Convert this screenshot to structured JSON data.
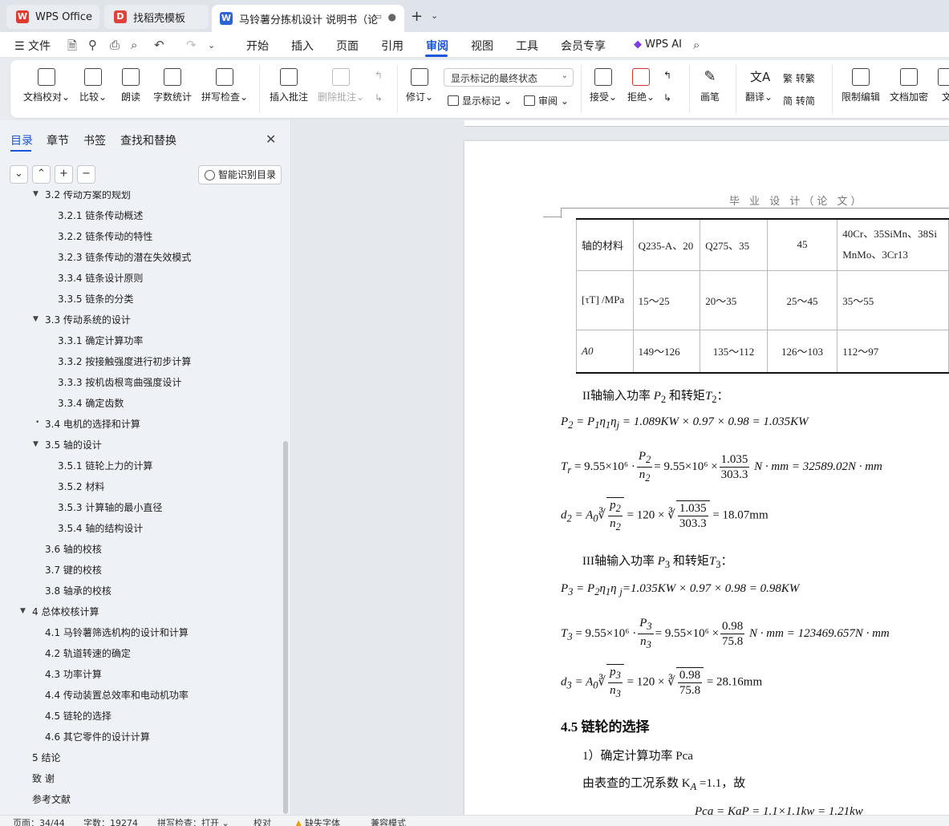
{
  "tabs": [
    {
      "label": "WPS Office",
      "icon": "wps-logo-icon"
    },
    {
      "label": "找稻壳模板",
      "icon": "docer-icon"
    },
    {
      "label": "马铃薯分拣机设计 说明书（论",
      "icon": "word-doc-icon"
    }
  ],
  "menu": {
    "file": "文件",
    "items": [
      "开始",
      "插入",
      "页面",
      "引用",
      "审阅",
      "视图",
      "工具",
      "会员专享"
    ],
    "active": "审阅",
    "ai": "WPS AI"
  },
  "ribbon": {
    "proofread": "文档校对",
    "compare": "比较",
    "read_aloud": "朗读",
    "word_count": "字数统计",
    "spell_check": "拼写检查",
    "insert_comment": "插入批注",
    "delete_comment": "删除批注",
    "track_changes": "修订",
    "markup_state": "显示标记的最终状态",
    "show_markup": "显示标记",
    "review": "审阅",
    "accept": "接受",
    "reject": "拒绝",
    "ink": "画笔",
    "translate": "翻译",
    "to_traditional": "转繁",
    "to_simplified": "转简",
    "restrict_edit": "限制编辑",
    "encrypt": "文档加密",
    "more": "文"
  },
  "panel": {
    "tabs": [
      "目录",
      "章节",
      "书签",
      "查找和替换"
    ],
    "smart_toc": "智能识别目录",
    "toc": [
      {
        "label": "3.2 传动方案的规划",
        "level": 1,
        "arrow": true
      },
      {
        "label": "3.2.1  链条传动概述",
        "level": 2
      },
      {
        "label": "3.2.2  链条传动的特性",
        "level": 2
      },
      {
        "label": "3.2.3  链条传动的潜在失效模式",
        "level": 2
      },
      {
        "label": "3.3.4  链条设计原则",
        "level": 2
      },
      {
        "label": "3.3.5  链条的分类",
        "level": 2
      },
      {
        "label": "3.3 传动系统的设计",
        "level": 1,
        "arrow": true
      },
      {
        "label": "3.3.1 确定计算功率",
        "level": 2
      },
      {
        "label": "3.3.2 按接触强度进行初步计算",
        "level": 2
      },
      {
        "label": "3.3.3 按机齿根弯曲强度设计",
        "level": 2
      },
      {
        "label": "3.3.4 确定齿数",
        "level": 2
      },
      {
        "label": "3.4 电机的选择和计算",
        "level": 1,
        "dot": true
      },
      {
        "label": "3.5 轴的设计",
        "level": 1,
        "arrow": true
      },
      {
        "label": "3.5.1 链轮上力的计算",
        "level": 2
      },
      {
        "label": "3.5.2 材料",
        "level": 2
      },
      {
        "label": "3.5.3 计算轴的最小直径",
        "level": 2
      },
      {
        "label": "3.5.4 轴的结构设计",
        "level": 2
      },
      {
        "label": "3.6 轴的校核",
        "level": 1
      },
      {
        "label": "3.7 键的校核",
        "level": 1
      },
      {
        "label": "3.8 轴承的校核",
        "level": 1
      },
      {
        "label": "4  总体校核计算",
        "level": 0,
        "arrow": true
      },
      {
        "label": "4.1  马铃薯筛选机构的设计和计算",
        "level": 1
      },
      {
        "label": "4.2  轨道转速的确定",
        "level": 1
      },
      {
        "label": "4.3  功率计算",
        "level": 1
      },
      {
        "label": "4.4  传动装置总效率和电动机功率",
        "level": 1
      },
      {
        "label": "4.5  链轮的选择",
        "level": 1
      },
      {
        "label": "4.6 其它零件的设计计算",
        "level": 1
      },
      {
        "label": "5  结论",
        "level": 0
      },
      {
        "label": "致    谢",
        "level": 0
      },
      {
        "label": "参考文献",
        "level": 0
      }
    ]
  },
  "document": {
    "header": "毕 业 设 计（论 文）",
    "table": {
      "rows": [
        [
          "轴的材料",
          "Q235-A、20",
          "Q275、35",
          "45",
          "40Cr、35SiMn、38SiMnMo、3Cr13"
        ],
        [
          "[τT] /MPa",
          "15～25",
          "20～35",
          "25～45",
          "35～55"
        ],
        [
          "A0",
          "149～126",
          "135～112",
          "126～103",
          "112～97"
        ]
      ]
    },
    "p_shaft2": "II轴输入功率",
    "p_shaft2_mid": "和转矩",
    "p_shaft3": "III轴输入功率",
    "p_shaft3_mid": "和转矩",
    "eq_p2": "= 1.089KW × 0.97 × 0.98 = 1.035KW",
    "eq_t2_a": "= 9.55×10⁶ ·",
    "eq_t2_b": "= 9.55×10⁶ ×",
    "eq_t2_c": "N · mm = 32589.02N · mm",
    "eq_d2_res": "= 18.07mm",
    "eq_p3": "=1.035KW × 0.97 × 0.98 = 0.98KW",
    "eq_t3_c": "N · mm = 123469.657N · mm",
    "eq_d3_res": "= 28.16mm",
    "sec_45": "4.5  链轮的选择",
    "step1": "1）确定计算功率 Pca",
    "step2": "由表查的工况系数 K",
    "step2_b": "=1.1，故",
    "last_line": "Pca = KaP = 1.1×1.1kw = 1.21kw"
  },
  "status": {
    "page": "页面：34/44",
    "words": "字数：19274",
    "spell": "拼写检查：打开",
    "proof": "校对",
    "missing_font": "缺失字体",
    "compat": "兼容模式"
  }
}
